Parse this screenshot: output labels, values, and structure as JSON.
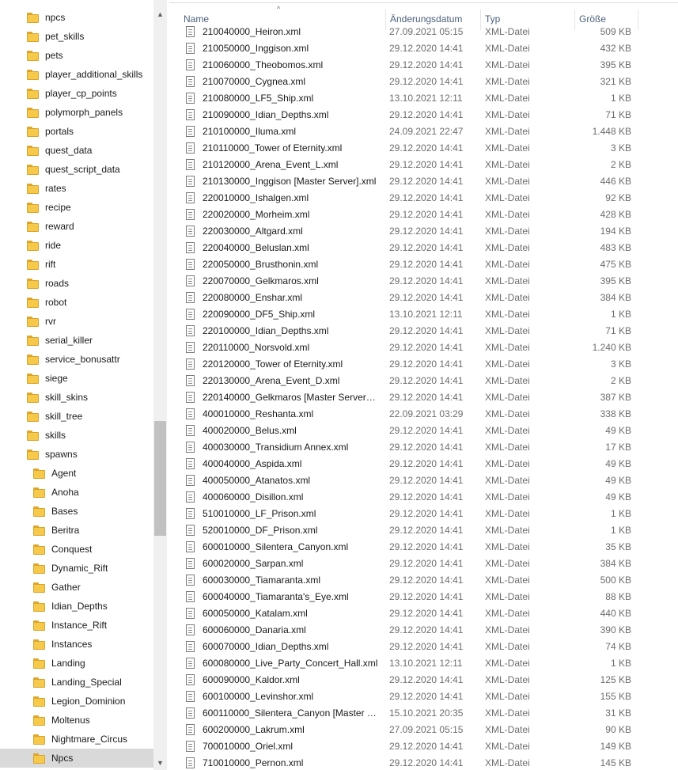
{
  "nav": {
    "items": [
      {
        "label": "npcs",
        "level": 0
      },
      {
        "label": "pet_skills",
        "level": 0
      },
      {
        "label": "pets",
        "level": 0
      },
      {
        "label": "player_additional_skills",
        "level": 0
      },
      {
        "label": "player_cp_points",
        "level": 0
      },
      {
        "label": "polymorph_panels",
        "level": 0
      },
      {
        "label": "portals",
        "level": 0
      },
      {
        "label": "quest_data",
        "level": 0
      },
      {
        "label": "quest_script_data",
        "level": 0
      },
      {
        "label": "rates",
        "level": 0
      },
      {
        "label": "recipe",
        "level": 0
      },
      {
        "label": "reward",
        "level": 0
      },
      {
        "label": "ride",
        "level": 0
      },
      {
        "label": "rift",
        "level": 0
      },
      {
        "label": "roads",
        "level": 0
      },
      {
        "label": "robot",
        "level": 0
      },
      {
        "label": "rvr",
        "level": 0
      },
      {
        "label": "serial_killer",
        "level": 0
      },
      {
        "label": "service_bonusattr",
        "level": 0
      },
      {
        "label": "siege",
        "level": 0
      },
      {
        "label": "skill_skins",
        "level": 0
      },
      {
        "label": "skill_tree",
        "level": 0
      },
      {
        "label": "skills",
        "level": 0
      },
      {
        "label": "spawns",
        "level": 0
      },
      {
        "label": "Agent",
        "level": 1
      },
      {
        "label": "Anoha",
        "level": 1
      },
      {
        "label": "Bases",
        "level": 1
      },
      {
        "label": "Beritra",
        "level": 1
      },
      {
        "label": "Conquest",
        "level": 1
      },
      {
        "label": "Dynamic_Rift",
        "level": 1
      },
      {
        "label": "Gather",
        "level": 1
      },
      {
        "label": "Idian_Depths",
        "level": 1
      },
      {
        "label": "Instance_Rift",
        "level": 1
      },
      {
        "label": "Instances",
        "level": 1
      },
      {
        "label": "Landing",
        "level": 1
      },
      {
        "label": "Landing_Special",
        "level": 1
      },
      {
        "label": "Legion_Dominion",
        "level": 1
      },
      {
        "label": "Moltenus",
        "level": 1
      },
      {
        "label": "Nightmare_Circus",
        "level": 1
      },
      {
        "label": "Npcs",
        "level": 1,
        "selected": true
      }
    ]
  },
  "columns": {
    "name": "Name",
    "date": "Änderungsdatum",
    "type": "Typ",
    "size": "Größe"
  },
  "files": [
    {
      "name": "210040000_Heiron.xml",
      "date": "27.09.2021 05:15",
      "type": "XML-Datei",
      "size": "509 KB"
    },
    {
      "name": "210050000_Inggison.xml",
      "date": "29.12.2020 14:41",
      "type": "XML-Datei",
      "size": "432 KB"
    },
    {
      "name": "210060000_Theobomos.xml",
      "date": "29.12.2020 14:41",
      "type": "XML-Datei",
      "size": "395 KB"
    },
    {
      "name": "210070000_Cygnea.xml",
      "date": "29.12.2020 14:41",
      "type": "XML-Datei",
      "size": "321 KB"
    },
    {
      "name": "210080000_LF5_Ship.xml",
      "date": "13.10.2021 12:11",
      "type": "XML-Datei",
      "size": "1 KB"
    },
    {
      "name": "210090000_Idian_Depths.xml",
      "date": "29.12.2020 14:41",
      "type": "XML-Datei",
      "size": "71 KB"
    },
    {
      "name": "210100000_Iluma.xml",
      "date": "24.09.2021 22:47",
      "type": "XML-Datei",
      "size": "1.448 KB"
    },
    {
      "name": "210110000_Tower of Eternity.xml",
      "date": "29.12.2020 14:41",
      "type": "XML-Datei",
      "size": "3 KB"
    },
    {
      "name": "210120000_Arena_Event_L.xml",
      "date": "29.12.2020 14:41",
      "type": "XML-Datei",
      "size": "2 KB"
    },
    {
      "name": "210130000_Inggison [Master Server].xml",
      "date": "29.12.2020 14:41",
      "type": "XML-Datei",
      "size": "446 KB"
    },
    {
      "name": "220010000_Ishalgen.xml",
      "date": "29.12.2020 14:41",
      "type": "XML-Datei",
      "size": "92 KB"
    },
    {
      "name": "220020000_Morheim.xml",
      "date": "29.12.2020 14:41",
      "type": "XML-Datei",
      "size": "428 KB"
    },
    {
      "name": "220030000_Altgard.xml",
      "date": "29.12.2020 14:41",
      "type": "XML-Datei",
      "size": "194 KB"
    },
    {
      "name": "220040000_Beluslan.xml",
      "date": "29.12.2020 14:41",
      "type": "XML-Datei",
      "size": "483 KB"
    },
    {
      "name": "220050000_Brusthonin.xml",
      "date": "29.12.2020 14:41",
      "type": "XML-Datei",
      "size": "475 KB"
    },
    {
      "name": "220070000_Gelkmaros.xml",
      "date": "29.12.2020 14:41",
      "type": "XML-Datei",
      "size": "395 KB"
    },
    {
      "name": "220080000_Enshar.xml",
      "date": "29.12.2020 14:41",
      "type": "XML-Datei",
      "size": "384 KB"
    },
    {
      "name": "220090000_DF5_Ship.xml",
      "date": "13.10.2021 12:11",
      "type": "XML-Datei",
      "size": "1 KB"
    },
    {
      "name": "220100000_Idian_Depths.xml",
      "date": "29.12.2020 14:41",
      "type": "XML-Datei",
      "size": "71 KB"
    },
    {
      "name": "220110000_Norsvold.xml",
      "date": "29.12.2020 14:41",
      "type": "XML-Datei",
      "size": "1.240 KB"
    },
    {
      "name": "220120000_Tower of Eternity.xml",
      "date": "29.12.2020 14:41",
      "type": "XML-Datei",
      "size": "3 KB"
    },
    {
      "name": "220130000_Arena_Event_D.xml",
      "date": "29.12.2020 14:41",
      "type": "XML-Datei",
      "size": "2 KB"
    },
    {
      "name": "220140000_Gelkmaros [Master Server].xml",
      "date": "29.12.2020 14:41",
      "type": "XML-Datei",
      "size": "387 KB"
    },
    {
      "name": "400010000_Reshanta.xml",
      "date": "22.09.2021 03:29",
      "type": "XML-Datei",
      "size": "338 KB"
    },
    {
      "name": "400020000_Belus.xml",
      "date": "29.12.2020 14:41",
      "type": "XML-Datei",
      "size": "49 KB"
    },
    {
      "name": "400030000_Transidium Annex.xml",
      "date": "29.12.2020 14:41",
      "type": "XML-Datei",
      "size": "17 KB"
    },
    {
      "name": "400040000_Aspida.xml",
      "date": "29.12.2020 14:41",
      "type": "XML-Datei",
      "size": "49 KB"
    },
    {
      "name": "400050000_Atanatos.xml",
      "date": "29.12.2020 14:41",
      "type": "XML-Datei",
      "size": "49 KB"
    },
    {
      "name": "400060000_Disillon.xml",
      "date": "29.12.2020 14:41",
      "type": "XML-Datei",
      "size": "49 KB"
    },
    {
      "name": "510010000_LF_Prison.xml",
      "date": "29.12.2020 14:41",
      "type": "XML-Datei",
      "size": "1 KB"
    },
    {
      "name": "520010000_DF_Prison.xml",
      "date": "29.12.2020 14:41",
      "type": "XML-Datei",
      "size": "1 KB"
    },
    {
      "name": "600010000_Silentera_Canyon.xml",
      "date": "29.12.2020 14:41",
      "type": "XML-Datei",
      "size": "35 KB"
    },
    {
      "name": "600020000_Sarpan.xml",
      "date": "29.12.2020 14:41",
      "type": "XML-Datei",
      "size": "384 KB"
    },
    {
      "name": "600030000_Tiamaranta.xml",
      "date": "29.12.2020 14:41",
      "type": "XML-Datei",
      "size": "500 KB"
    },
    {
      "name": "600040000_Tiamaranta's_Eye.xml",
      "date": "29.12.2020 14:41",
      "type": "XML-Datei",
      "size": "88 KB"
    },
    {
      "name": "600050000_Katalam.xml",
      "date": "29.12.2020 14:41",
      "type": "XML-Datei",
      "size": "440 KB"
    },
    {
      "name": "600060000_Danaria.xml",
      "date": "29.12.2020 14:41",
      "type": "XML-Datei",
      "size": "390 KB"
    },
    {
      "name": "600070000_Idian_Depths.xml",
      "date": "29.12.2020 14:41",
      "type": "XML-Datei",
      "size": "74 KB"
    },
    {
      "name": "600080000_Live_Party_Concert_Hall.xml",
      "date": "13.10.2021 12:11",
      "type": "XML-Datei",
      "size": "1 KB"
    },
    {
      "name": "600090000_Kaldor.xml",
      "date": "29.12.2020 14:41",
      "type": "XML-Datei",
      "size": "125 KB"
    },
    {
      "name": "600100000_Levinshor.xml",
      "date": "29.12.2020 14:41",
      "type": "XML-Datei",
      "size": "155 KB"
    },
    {
      "name": "600110000_Silentera_Canyon [Master Ser...",
      "date": "15.10.2021 20:35",
      "type": "XML-Datei",
      "size": "31 KB"
    },
    {
      "name": "600200000_Lakrum.xml",
      "date": "27.09.2021 05:15",
      "type": "XML-Datei",
      "size": "90 KB"
    },
    {
      "name": "700010000_Oriel.xml",
      "date": "29.12.2020 14:41",
      "type": "XML-Datei",
      "size": "149 KB"
    },
    {
      "name": "710010000_Pernon.xml",
      "date": "29.12.2020 14:41",
      "type": "XML-Datei",
      "size": "145 KB"
    }
  ]
}
